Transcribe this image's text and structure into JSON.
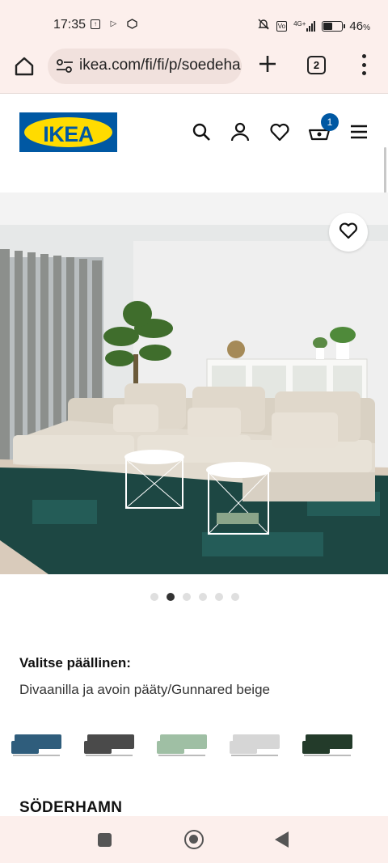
{
  "status_bar": {
    "time": "17:35",
    "network": "4G+",
    "battery_level": 0.46,
    "battery_text": "46",
    "battery_unit": "%",
    "icons": [
      "upload-icon",
      "play-icon",
      "mi-icon",
      "mute-icon",
      "volte-icon",
      "signal-icon",
      "battery-icon"
    ]
  },
  "browser": {
    "url": "ikea.com/fi/fi/p/soedehamn",
    "tab_count": "2",
    "icons": [
      "home-icon",
      "site-settings-icon",
      "new-tab-icon",
      "tab-switcher-icon",
      "overflow-menu-icon"
    ]
  },
  "header": {
    "logo_text": "IKEA",
    "cart_count": "1",
    "icons": [
      "search-icon",
      "account-icon",
      "wishlist-icon",
      "cart-icon",
      "hamburger-menu-icon"
    ],
    "brand_blue": "#0058a3",
    "brand_yellow": "#ffdb00"
  },
  "product": {
    "carousel_count": 6,
    "carousel_active_index": 1,
    "cover_heading": "Valitse päällinen:",
    "cover_value": "Divaanilla ja avoin pääty/Gunnared beige",
    "name": "SÖDERHAMN",
    "swatches": [
      {
        "name": "blue",
        "color": "#2f5d7c"
      },
      {
        "name": "dark-grey",
        "color": "#4a4a4a"
      },
      {
        "name": "light-green",
        "color": "#9fbfa4"
      },
      {
        "name": "light-grey",
        "color": "#d6d6d6"
      },
      {
        "name": "dark-green",
        "color": "#233b2a"
      }
    ]
  }
}
